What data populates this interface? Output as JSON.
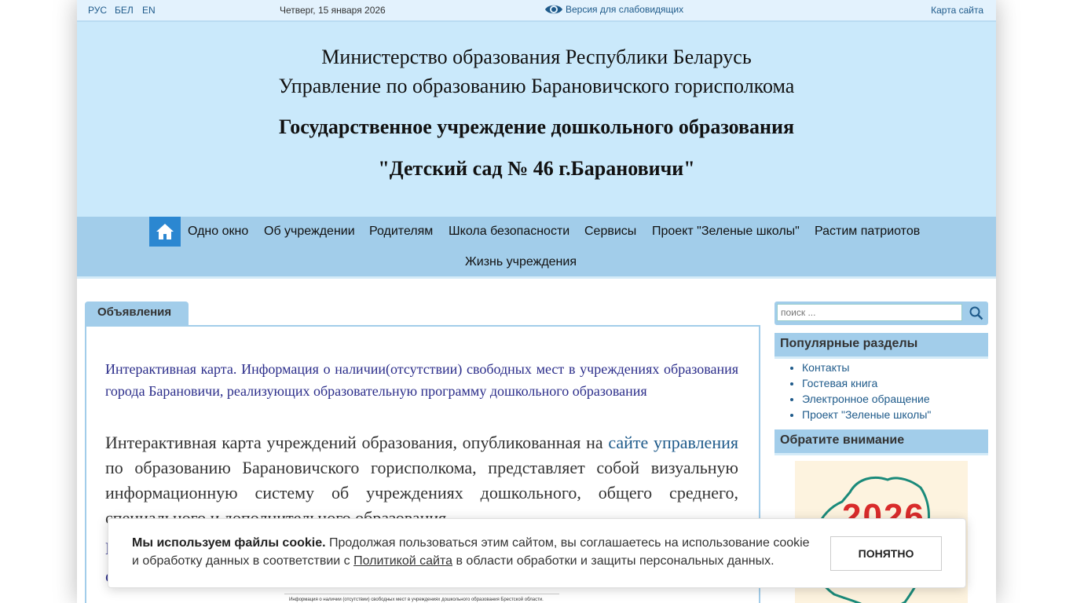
{
  "topbar": {
    "langs": [
      "РУС",
      "БЕЛ",
      "EN"
    ],
    "date": "Четверг, 15 января 2026",
    "vision_label": "Версия для слабовидящих",
    "sitemap": "Карта сайта"
  },
  "header": {
    "line1": "Министерство образования Республики Беларусь",
    "line2": "Управление по образованию Барановичского горисполкома",
    "line3": "Государственное учреждение дошкольного образования",
    "line4": "\"Детский сад № 46 г.Барановичи\""
  },
  "nav": {
    "items": [
      "Одно окно",
      "Об учреждении",
      "Родителям",
      "Школа безопасности",
      "Сервисы",
      "Проект \"Зеленые школы\"",
      "Растим патриотов",
      "Жизнь учреждения"
    ]
  },
  "main": {
    "tab_title": "Объявления",
    "news_title": "Интерактивная карта. Информация о  наличии(отсутствии)  свободных мест в учреждениях образования города Барановичи, реализующих образовательную программу дошкольного образования",
    "para_start": "Интерактивная карта учреждений образования, опубликованная на ",
    "para_link": "сайте управления",
    "para_end": " по образованию Барановичского горисполкома, представляет собой визуальную информационную систему об учреждениях дошкольного, общего среднего, специального и дополнительного образования.",
    "para2_fragment": "И",
    "para3_fragment": "о",
    "thumb_caption": "Информация о наличии (отсутствии) свободных мест в учреждениях дошкольного образования Брестской области."
  },
  "sidebar": {
    "search_placeholder": "поиск ...",
    "popular_title": "Популярные разделы",
    "popular_items": [
      "Контакты",
      "Гостевая книга",
      "Электронное обращение",
      "Проект \"Зеленые школы\""
    ],
    "attention_title": "Обратите внимание",
    "poster_year": "2026"
  },
  "cookie": {
    "bold": "Мы используем файлы cookie.",
    "text1": " Продолжая пользоваться этим сайтом, вы соглашаетесь на использование cookie и обработку данных в соответствии с ",
    "policy_link": "Политикой сайта",
    "text2": " в области обработки и защиты персональных данных.",
    "button": "ПОНЯТНО"
  }
}
